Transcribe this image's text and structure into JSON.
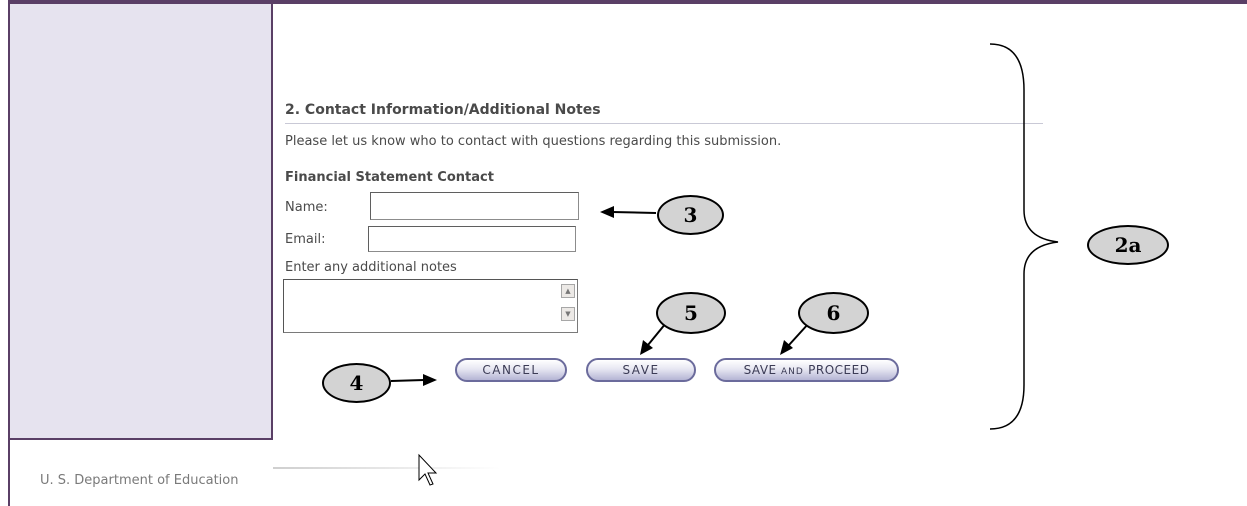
{
  "section": {
    "title": "2. Contact Information/Additional Notes",
    "instructions": "Please let us know who to contact with questions regarding this submission."
  },
  "contact": {
    "heading": "Financial Statement Contact",
    "name_label": "Name:",
    "name_value": "",
    "email_label": "Email:",
    "email_value": "",
    "notes_label": "Enter any additional notes",
    "notes_value": ""
  },
  "buttons": {
    "cancel": "CANCEL",
    "save": "SAVE",
    "proceed_a": "SAVE",
    "proceed_b": "AND",
    "proceed_c": "PROCEED"
  },
  "footer": "U. S. Department of Education",
  "callouts": {
    "c3": "3",
    "c4": "4",
    "c5": "5",
    "c6": "6",
    "c2a": "2a"
  }
}
